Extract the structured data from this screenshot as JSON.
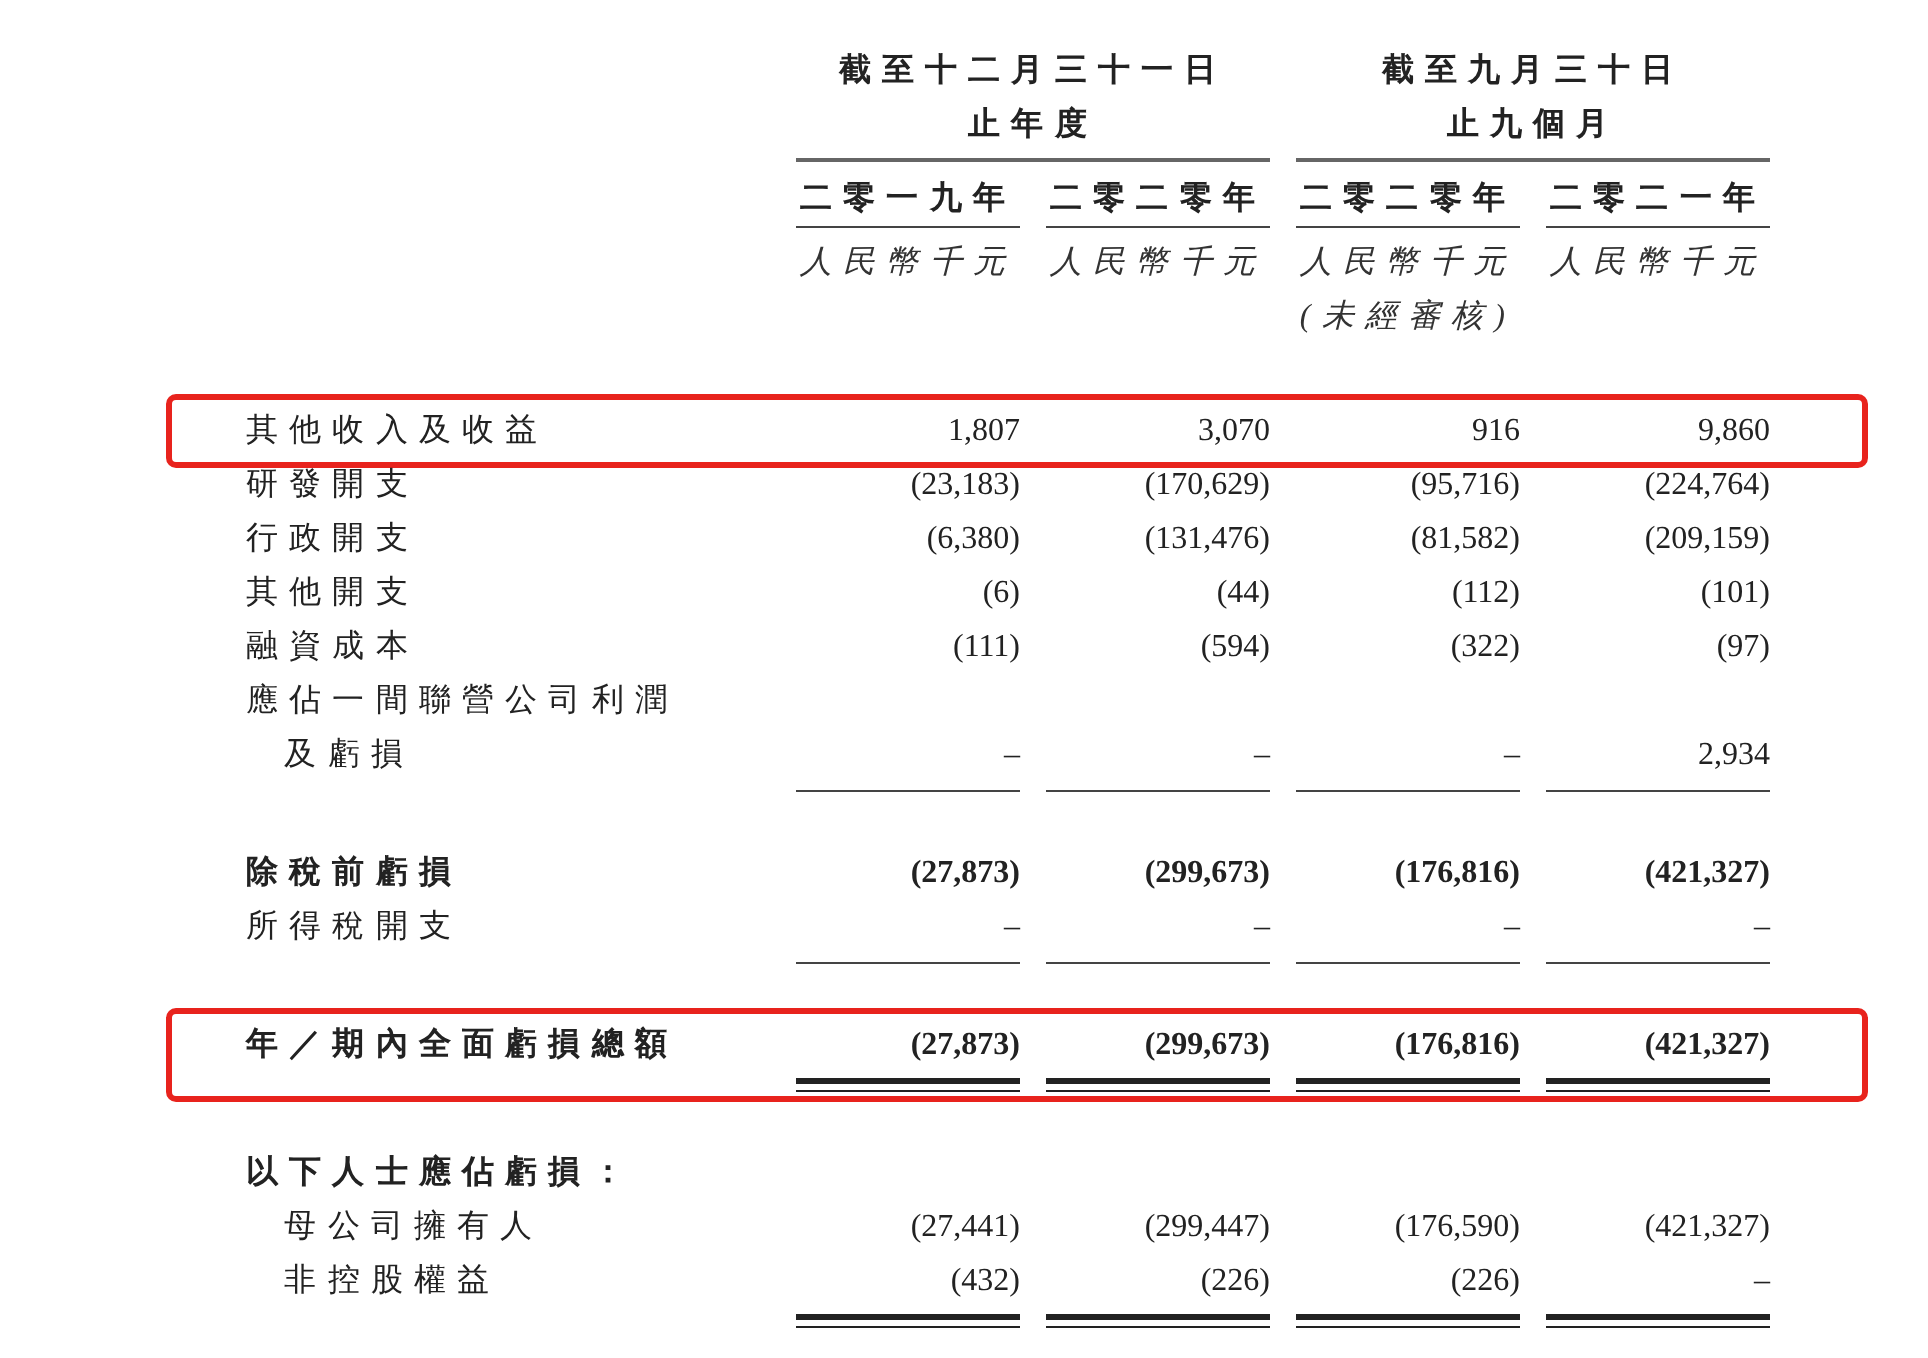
{
  "column_groups": [
    {
      "lines": [
        "截至十二月三十一日",
        "止年度"
      ]
    },
    {
      "lines": [
        "截至九月三十日",
        "止九個月"
      ]
    }
  ],
  "columns": [
    {
      "year": "二零一九年",
      "unit": "人民幣千元"
    },
    {
      "year": "二零二零年",
      "unit": "人民幣千元"
    },
    {
      "year": "二零二零年",
      "unit": "人民幣千元",
      "note": "(未經審核)"
    },
    {
      "year": "二零二一年",
      "unit": "人民幣千元"
    }
  ],
  "rows": [
    {
      "label_lines": [
        "其他收入及收益"
      ],
      "values": [
        "1,807",
        "3,070",
        "916",
        "9,860"
      ],
      "bold": false,
      "highlighted": true
    },
    {
      "label_lines": [
        "研發開支"
      ],
      "values": [
        "(23,183)",
        "(170,629)",
        "(95,716)",
        "(224,764)"
      ],
      "bold": false,
      "highlighted": false
    },
    {
      "label_lines": [
        "行政開支"
      ],
      "values": [
        "(6,380)",
        "(131,476)",
        "(81,582)",
        "(209,159)"
      ],
      "bold": false,
      "highlighted": false
    },
    {
      "label_lines": [
        "其他開支"
      ],
      "values": [
        "(6)",
        "(44)",
        "(112)",
        "(101)"
      ],
      "bold": false,
      "highlighted": false
    },
    {
      "label_lines": [
        "融資成本"
      ],
      "values": [
        "(111)",
        "(594)",
        "(322)",
        "(97)"
      ],
      "bold": false,
      "highlighted": false
    },
    {
      "label_lines": [
        "應佔一間聯營公司利潤",
        "及虧損"
      ],
      "values": [
        "–",
        "–",
        "–",
        "2,934"
      ],
      "bold": false,
      "highlighted": false,
      "single_rule": true
    },
    {
      "label_lines": [
        "除稅前虧損"
      ],
      "values": [
        "(27,873)",
        "(299,673)",
        "(176,816)",
        "(421,327)"
      ],
      "bold": true,
      "highlighted": false
    },
    {
      "label_lines": [
        "所得稅開支"
      ],
      "values": [
        "–",
        "–",
        "–",
        "–"
      ],
      "bold": false,
      "highlighted": false,
      "single_rule": true
    },
    {
      "label_lines": [
        "年／期內全面虧損總額"
      ],
      "values": [
        "(27,873)",
        "(299,673)",
        "(176,816)",
        "(421,327)"
      ],
      "bold": true,
      "highlighted": true,
      "double_rule": true
    },
    {
      "label_lines": [
        "以下人士應佔虧損："
      ],
      "bold": true,
      "highlighted": false,
      "children": [
        {
          "label_lines": [
            "母公司擁有人"
          ],
          "values": [
            "(27,441)",
            "(299,447)",
            "(176,590)",
            "(421,327)"
          ],
          "bold": false,
          "highlighted": false
        },
        {
          "label_lines": [
            "非控股權益"
          ],
          "values": [
            "(432)",
            "(226)",
            "(226)",
            "–"
          ],
          "bold": false,
          "highlighted": false,
          "double_rule": true
        }
      ]
    }
  ]
}
